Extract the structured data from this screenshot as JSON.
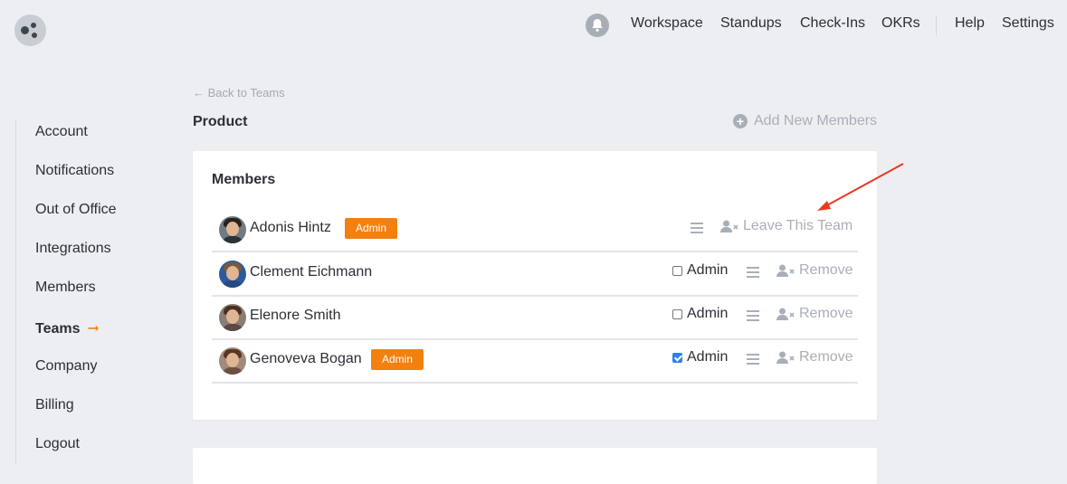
{
  "topbar": {
    "nav": [
      "Workspace",
      "Standups",
      "Check-Ins",
      "OKRs"
    ],
    "help": "Help",
    "settings": "Settings"
  },
  "sidebar": {
    "items": [
      {
        "label": "Account"
      },
      {
        "label": "Notifications"
      },
      {
        "label": "Out of Office"
      },
      {
        "label": "Integrations"
      },
      {
        "label": "Members"
      },
      {
        "label": "Teams",
        "active": true,
        "arrow": "➞"
      },
      {
        "label": "Company"
      },
      {
        "label": "Billing"
      },
      {
        "label": "Logout"
      }
    ]
  },
  "header": {
    "back_label": "← Back to Teams",
    "team_name": "Product",
    "add_members_label": "Add New Members"
  },
  "members_card": {
    "title": "Members",
    "rows": [
      {
        "name": "Adonis Hintz",
        "badge": "Admin",
        "action": "Leave This Team"
      },
      {
        "name": "Clement Eichmann",
        "admin_label": "Admin",
        "admin_checked": false,
        "action": "Remove"
      },
      {
        "name": "Elenore Smith",
        "admin_label": "Admin",
        "admin_checked": false,
        "action": "Remove"
      },
      {
        "name": "Genoveva Bogan",
        "badge": "Admin",
        "admin_label": "Admin",
        "admin_checked": true,
        "action": "Remove"
      }
    ]
  },
  "colors": {
    "accent": "#f3800f",
    "annotation_arrow": "#e8391f",
    "checkbox_checked": "#2f7ff0"
  }
}
